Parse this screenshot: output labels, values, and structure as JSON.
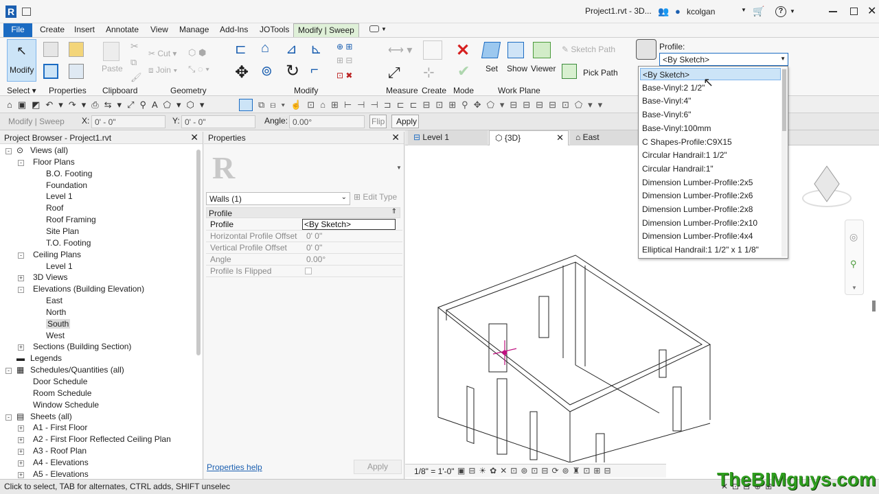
{
  "title_bar": {
    "app_letter": "R",
    "title": "Project1.rvt - 3D...",
    "user": "kcolgan",
    "help": "?"
  },
  "tabs": [
    "File",
    "Create",
    "Insert",
    "Annotate",
    "View",
    "Manage",
    "Add-Ins",
    "JOTools",
    "Modify | Sweep"
  ],
  "ribbon": {
    "modify_label": "Modify",
    "panels": [
      "Select ▾",
      "Properties",
      "Clipboard",
      "Geometry",
      "Modify",
      "Measure",
      "Create",
      "Mode",
      "Work Plane"
    ],
    "paste": "Paste",
    "cut": "Cut",
    "join": "Join",
    "set": "Set",
    "show": "Show",
    "viewer": "Viewer",
    "sketch_path": "Sketch Path",
    "pick_path": "Pick Path",
    "profile_label": "Profile:",
    "profile_value": "<By Sketch>"
  },
  "options_bar": {
    "context": "Modify | Sweep",
    "x_label": "X:",
    "x_value": "0' - 0\"",
    "y_label": "Y:",
    "y_value": "0' - 0\"",
    "angle_label": "Angle:",
    "angle_value": "0.00°",
    "flip": "Flip",
    "apply": "Apply"
  },
  "project_browser": {
    "title": "Project Browser - Project1.rvt",
    "items": [
      "Views (all)",
      "Floor Plans",
      "B.O. Footing",
      "Foundation",
      "Level 1",
      "Roof",
      "Roof Framing",
      "Site Plan",
      "T.O. Footing",
      "Ceiling Plans",
      "Level 1",
      "3D Views",
      "Elevations (Building Elevation)",
      "East",
      "North",
      "South",
      "West",
      "Sections (Building Section)",
      "Legends",
      "Schedules/Quantities (all)",
      "Door Schedule",
      "Room Schedule",
      "Window Schedule",
      "Sheets (all)",
      "A1 - First Floor",
      "A2 - First Floor Reflected Ceiling Plan",
      "A3 - Roof Plan",
      "A4 - Elevations",
      "A5 - Elevations"
    ]
  },
  "properties": {
    "title": "Properties",
    "type_selector": "Walls (1)",
    "edit_type": "Edit Type",
    "group": "Profile",
    "rows": [
      [
        "Profile",
        "<By Sketch>"
      ],
      [
        "Horizontal Profile Offset",
        "0'  0\""
      ],
      [
        "Vertical Profile Offset",
        "0'  0\""
      ],
      [
        "Angle",
        "0.00°"
      ],
      [
        "Profile Is Flipped",
        ""
      ]
    ],
    "help": "Properties help",
    "apply": "Apply"
  },
  "view_tabs": [
    "Level 1",
    "{3D}",
    "East"
  ],
  "profile_dropdown": [
    "<By Sketch>",
    "Base-Vinyl:2 1/2\"",
    "Base-Vinyl:4\"",
    "Base-Vinyl:6\"",
    "Base-Vinyl:100mm",
    "C Shapes-Profile:C9X15",
    "Circular Handrail:1 1/2\"",
    "Circular Handrail:1\"",
    "Dimension Lumber-Profile:2x5",
    "Dimension Lumber-Profile:2x6",
    "Dimension Lumber-Profile:2x8",
    "Dimension Lumber-Profile:2x10",
    "Dimension Lumber-Profile:4x4",
    "Elliptical Handrail:1 1/2\" x 1 1/8\""
  ],
  "view_control": {
    "scale": "1/8\" = 1'-0\""
  },
  "status": {
    "hint": "Click to select, TAB for alternates, CTRL adds, SHIFT unselec"
  },
  "watermark": "TheBIMguys.com",
  "colors": {
    "file_tab": "#1b6bc2",
    "selection": "#cce4f7",
    "watermark": "#2f9e1f"
  }
}
